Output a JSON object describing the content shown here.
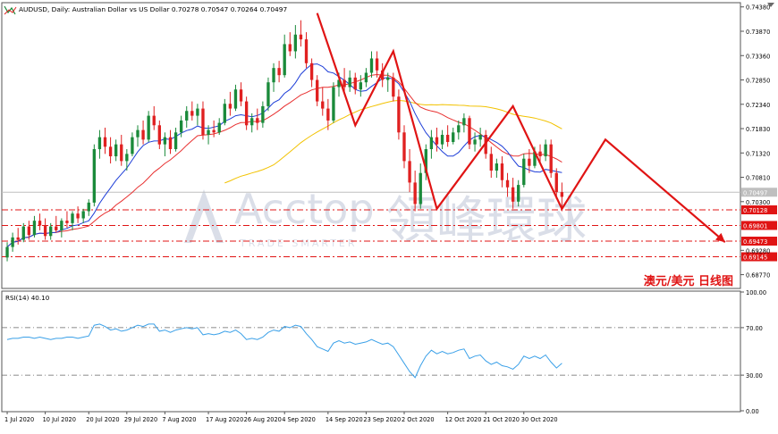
{
  "header": {
    "symbol_info": "AUDUSD, Daily:  Australian Dollar vs US Dollar  0.70278 0.70547 0.70264 0.70497"
  },
  "watermark": {
    "brand": "Acctop",
    "brand_cn": "領峰環球",
    "tagline": "TRADE SMARTER"
  },
  "caption": "澳元/美元  日线图",
  "colors": {
    "bull_candle": "#1a8a3a",
    "bear_candle": "#e02020",
    "ma_fast": "#1f3fd8",
    "ma_mid": "#e83030",
    "ma_slow": "#f2c200",
    "rsi_line": "#3aa0e8",
    "annotation": "#e01414",
    "level_line": "#e01414",
    "price_marker": "#bfbfbf"
  },
  "chart_data": [
    {
      "type": "candlestick",
      "title": "AUDUSD, Daily",
      "y_ticks": [
        "0.74380",
        "0.73870",
        "0.73360",
        "0.72850",
        "0.72340",
        "0.71830",
        "0.71320",
        "0.70810",
        "0.70300",
        "0.69280",
        "0.68770"
      ],
      "ylim": [
        0.685,
        0.7445
      ],
      "current_price": "0.70497",
      "levels": [
        {
          "label": "0.70128",
          "value": 0.70128
        },
        {
          "label": "0.69801",
          "value": 0.69801
        },
        {
          "label": "0.69473",
          "value": 0.69473
        },
        {
          "label": "0.69145",
          "value": 0.69145
        }
      ],
      "ohlc": [
        [
          0.6913,
          0.6945,
          0.6905,
          0.6935
        ],
        [
          0.6935,
          0.6965,
          0.6925,
          0.6955
        ],
        [
          0.6955,
          0.6975,
          0.694,
          0.695
        ],
        [
          0.695,
          0.6985,
          0.6945,
          0.6978
        ],
        [
          0.6978,
          0.699,
          0.695,
          0.696
        ],
        [
          0.696,
          0.7,
          0.6955,
          0.699
        ],
        [
          0.699,
          0.7005,
          0.697,
          0.698
        ],
        [
          0.698,
          0.6995,
          0.695,
          0.6958
        ],
        [
          0.6958,
          0.6985,
          0.695,
          0.6978
        ],
        [
          0.6978,
          0.7,
          0.6965,
          0.697
        ],
        [
          0.697,
          0.6995,
          0.6955,
          0.699
        ],
        [
          0.699,
          0.701,
          0.6975,
          0.6985
        ],
        [
          0.6985,
          0.701,
          0.697,
          0.7005
        ],
        [
          0.7005,
          0.702,
          0.6985,
          0.6995
        ],
        [
          0.6995,
          0.7015,
          0.6985,
          0.701
        ],
        [
          0.701,
          0.7035,
          0.7,
          0.7028
        ],
        [
          0.7028,
          0.715,
          0.702,
          0.714
        ],
        [
          0.714,
          0.718,
          0.712,
          0.7165
        ],
        [
          0.7165,
          0.7185,
          0.713,
          0.7145
        ],
        [
          0.7145,
          0.7165,
          0.711,
          0.7125
        ],
        [
          0.7125,
          0.716,
          0.7115,
          0.715
        ],
        [
          0.715,
          0.717,
          0.7105,
          0.7115
        ],
        [
          0.7115,
          0.714,
          0.7095,
          0.713
        ],
        [
          0.713,
          0.7175,
          0.7125,
          0.7165
        ],
        [
          0.7165,
          0.719,
          0.7145,
          0.718
        ],
        [
          0.718,
          0.72,
          0.715,
          0.716
        ],
        [
          0.716,
          0.722,
          0.7155,
          0.721
        ],
        [
          0.721,
          0.723,
          0.718,
          0.719
        ],
        [
          0.719,
          0.72,
          0.714,
          0.715
        ],
        [
          0.715,
          0.7175,
          0.7125,
          0.7165
        ],
        [
          0.7165,
          0.718,
          0.713,
          0.714
        ],
        [
          0.714,
          0.7185,
          0.7135,
          0.7175
        ],
        [
          0.7175,
          0.721,
          0.7165,
          0.72
        ],
        [
          0.72,
          0.723,
          0.7185,
          0.722
        ],
        [
          0.722,
          0.724,
          0.72,
          0.721
        ],
        [
          0.721,
          0.7235,
          0.719,
          0.7225
        ],
        [
          0.7225,
          0.724,
          0.716,
          0.717
        ],
        [
          0.717,
          0.719,
          0.715,
          0.718
        ],
        [
          0.718,
          0.72,
          0.7165,
          0.7175
        ],
        [
          0.7175,
          0.7205,
          0.717,
          0.7195
        ],
        [
          0.7195,
          0.7245,
          0.719,
          0.7235
        ],
        [
          0.7235,
          0.726,
          0.721,
          0.7225
        ],
        [
          0.7225,
          0.7275,
          0.722,
          0.7265
        ],
        [
          0.7265,
          0.728,
          0.723,
          0.724
        ],
        [
          0.724,
          0.725,
          0.718,
          0.719
        ],
        [
          0.719,
          0.7215,
          0.7175,
          0.7205
        ],
        [
          0.7205,
          0.7225,
          0.718,
          0.7195
        ],
        [
          0.7195,
          0.724,
          0.7185,
          0.723
        ],
        [
          0.723,
          0.729,
          0.722,
          0.728
        ],
        [
          0.728,
          0.732,
          0.726,
          0.731
        ],
        [
          0.731,
          0.7325,
          0.728,
          0.7295
        ],
        [
          0.7295,
          0.738,
          0.729,
          0.736
        ],
        [
          0.736,
          0.7385,
          0.7335,
          0.7345
        ],
        [
          0.7345,
          0.74,
          0.733,
          0.738
        ],
        [
          0.738,
          0.741,
          0.7355,
          0.737
        ],
        [
          0.737,
          0.7385,
          0.731,
          0.732
        ],
        [
          0.732,
          0.733,
          0.727,
          0.7285
        ],
        [
          0.7285,
          0.7295,
          0.723,
          0.724
        ],
        [
          0.724,
          0.727,
          0.721,
          0.7225
        ],
        [
          0.7225,
          0.7245,
          0.718,
          0.72
        ],
        [
          0.72,
          0.728,
          0.7195,
          0.727
        ],
        [
          0.727,
          0.73,
          0.725,
          0.7285
        ],
        [
          0.7285,
          0.731,
          0.726,
          0.727
        ],
        [
          0.727,
          0.7305,
          0.726,
          0.729
        ],
        [
          0.729,
          0.73,
          0.7255,
          0.7265
        ],
        [
          0.7265,
          0.7295,
          0.725,
          0.728
        ],
        [
          0.728,
          0.731,
          0.727,
          0.73
        ],
        [
          0.73,
          0.7345,
          0.729,
          0.733
        ],
        [
          0.733,
          0.7345,
          0.729,
          0.7305
        ],
        [
          0.7305,
          0.732,
          0.727,
          0.7285
        ],
        [
          0.7285,
          0.73,
          0.726,
          0.729
        ],
        [
          0.729,
          0.73,
          0.724,
          0.725
        ],
        [
          0.725,
          0.7265,
          0.716,
          0.7175
        ],
        [
          0.7175,
          0.719,
          0.71,
          0.7115
        ],
        [
          0.7115,
          0.714,
          0.705,
          0.707
        ],
        [
          0.707,
          0.7095,
          0.701,
          0.7025
        ],
        [
          0.7025,
          0.711,
          0.7015,
          0.709
        ],
        [
          0.709,
          0.715,
          0.7075,
          0.714
        ],
        [
          0.714,
          0.718,
          0.712,
          0.7165
        ],
        [
          0.7165,
          0.7185,
          0.7135,
          0.715
        ],
        [
          0.715,
          0.718,
          0.714,
          0.717
        ],
        [
          0.717,
          0.719,
          0.7145,
          0.7155
        ],
        [
          0.7155,
          0.7185,
          0.715,
          0.7175
        ],
        [
          0.7175,
          0.72,
          0.716,
          0.719
        ],
        [
          0.719,
          0.7215,
          0.7175,
          0.7205
        ],
        [
          0.7205,
          0.721,
          0.714,
          0.715
        ],
        [
          0.715,
          0.7175,
          0.7135,
          0.716
        ],
        [
          0.716,
          0.7185,
          0.7145,
          0.717
        ],
        [
          0.717,
          0.718,
          0.712,
          0.713
        ],
        [
          0.713,
          0.7145,
          0.708,
          0.7095
        ],
        [
          0.7095,
          0.712,
          0.708,
          0.711
        ],
        [
          0.711,
          0.7125,
          0.706,
          0.7075
        ],
        [
          0.7075,
          0.709,
          0.704,
          0.706
        ],
        [
          0.706,
          0.708,
          0.7015,
          0.703
        ],
        [
          0.703,
          0.7075,
          0.702,
          0.7065
        ],
        [
          0.7065,
          0.713,
          0.706,
          0.712
        ],
        [
          0.712,
          0.714,
          0.709,
          0.7105
        ],
        [
          0.7105,
          0.7145,
          0.71,
          0.7135
        ],
        [
          0.7135,
          0.715,
          0.711,
          0.7125
        ],
        [
          0.7125,
          0.716,
          0.7115,
          0.715
        ],
        [
          0.715,
          0.716,
          0.708,
          0.709
        ],
        [
          0.709,
          0.71,
          0.7035,
          0.705
        ],
        [
          0.705,
          0.707,
          0.701,
          0.704
        ]
      ],
      "moving_averages": [
        {
          "name": "fast",
          "period": 10
        },
        {
          "name": "mid",
          "period": 20
        },
        {
          "name": "slow",
          "period": 50
        }
      ],
      "annotation_path": [
        {
          "bar": 57,
          "price": 0.7425
        },
        {
          "bar": 64,
          "price": 0.719
        },
        {
          "bar": 71,
          "price": 0.7345
        },
        {
          "bar": 79,
          "price": 0.7015
        },
        {
          "bar": 93,
          "price": 0.723
        },
        {
          "bar": 102,
          "price": 0.7015
        },
        {
          "bar": 110,
          "price": 0.716
        },
        {
          "bar": 132,
          "price": 0.6945
        }
      ]
    },
    {
      "type": "line",
      "title": "RSI(14) 40.10",
      "y_ticks": [
        "100.00",
        "70.00",
        "30.00",
        "0.00"
      ],
      "ylim": [
        0,
        100
      ],
      "levels": [
        70,
        30
      ],
      "values": [
        60,
        61,
        61,
        62,
        62,
        61,
        62,
        61,
        60,
        61,
        61,
        62,
        62,
        61,
        62,
        63,
        72,
        73,
        71,
        68,
        69,
        67,
        68,
        70,
        72,
        71,
        73,
        73,
        67,
        68,
        66,
        68,
        69,
        70,
        69,
        70,
        64,
        65,
        64,
        65,
        67,
        66,
        68,
        65,
        60,
        61,
        60,
        62,
        66,
        68,
        67,
        71,
        70,
        72,
        71,
        65,
        60,
        54,
        52,
        50,
        57,
        59,
        57,
        58,
        56,
        57,
        58,
        60,
        58,
        56,
        57,
        54,
        47,
        40,
        33,
        28,
        38,
        46,
        51,
        48,
        50,
        48,
        49,
        51,
        52,
        44,
        46,
        47,
        42,
        39,
        41,
        38,
        37,
        35,
        39,
        46,
        44,
        46,
        44,
        47,
        41,
        36,
        40
      ],
      "current": "40.10"
    }
  ],
  "x_axis": {
    "labels": [
      "1 Jul 2020",
      "10 Jul 2020",
      "20 Jul 2020",
      "29 Jul 2020",
      "7 Aug 2020",
      "17 Aug 2020",
      "26 Aug 2020",
      "4 Sep 2020",
      "14 Sep 2020",
      "23 Sep 2020",
      "2 Oct 2020",
      "12 Oct 2020",
      "21 Oct 2020",
      "30 Oct 2020"
    ]
  }
}
